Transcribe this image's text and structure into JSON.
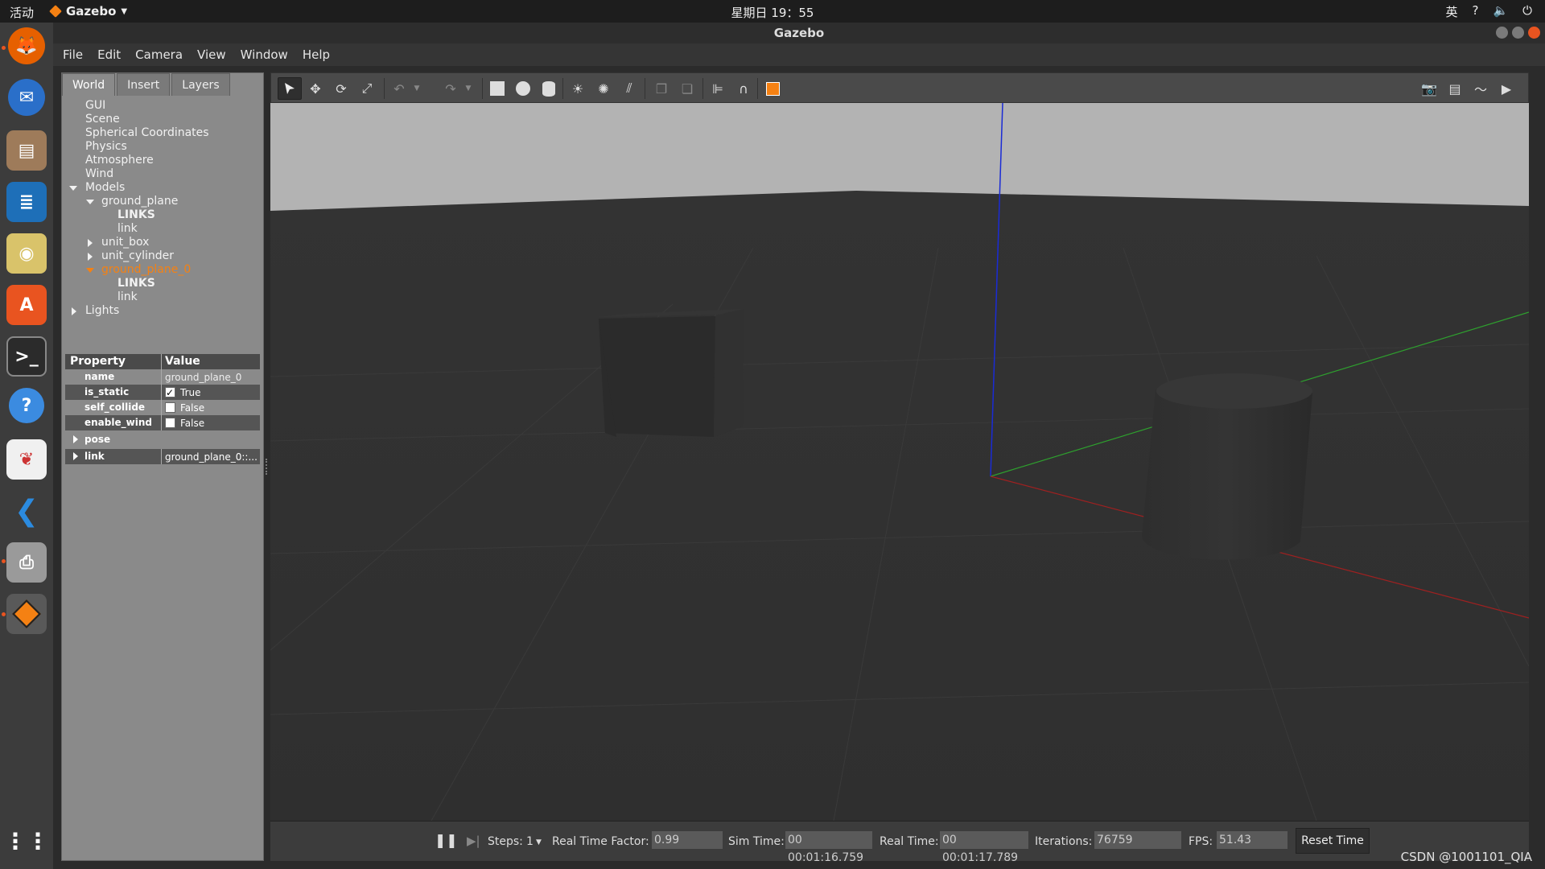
{
  "topbar": {
    "activities": "活动",
    "app_name": "Gazebo",
    "clock": "星期日 19：55",
    "ime": "英",
    "help": "?",
    "volume_icon": "volume-icon",
    "power_icon": "power-icon"
  },
  "dock": {
    "items": [
      "firefox-icon",
      "thunderbird-icon",
      "files-icon",
      "writer-icon",
      "rhythmbox-icon",
      "software-icon",
      "terminal-icon",
      "help-icon",
      "app-icon",
      "vscode-icon",
      "printer-icon",
      "gazebo-icon",
      "app-grid-icon"
    ]
  },
  "window": {
    "title": "Gazebo"
  },
  "menu": {
    "file": "File",
    "edit": "Edit",
    "camera": "Camera",
    "view": "View",
    "window": "Window",
    "help": "Help"
  },
  "panel": {
    "tabs": [
      "World",
      "Insert",
      "Layers"
    ],
    "tree": {
      "gui": "GUI",
      "scene": "Scene",
      "spherical": "Spherical Coordinates",
      "physics": "Physics",
      "atmosphere": "Atmosphere",
      "wind": "Wind",
      "models": "Models",
      "ground_plane": "ground_plane",
      "gp_links": "LINKS",
      "gp_link": "link",
      "unit_box": "unit_box",
      "unit_cylinder": "unit_cylinder",
      "ground_plane_0": "ground_plane_0",
      "gp0_links": "LINKS",
      "gp0_link": "link",
      "lights": "Lights"
    },
    "properties": {
      "header_property": "Property",
      "header_value": "Value",
      "name_key": "name",
      "name_val": "ground_plane_0",
      "is_static_key": "is_static",
      "is_static_val": "True",
      "self_collide_key": "self_collide",
      "self_collide_val": "False",
      "enable_wind_key": "enable_wind",
      "enable_wind_val": "False",
      "pose_key": "pose",
      "link_key": "link",
      "link_val": "ground_plane_0::..."
    }
  },
  "toolbar": {
    "icons": [
      "select-icon",
      "translate-icon",
      "rotate-icon",
      "scale-icon",
      "undo-icon",
      "redo-icon",
      "box-icon",
      "sphere-icon",
      "cylinder-icon",
      "point-light-icon",
      "spot-light-icon",
      "directional-light-icon",
      "copy-icon",
      "paste-icon",
      "align-icon",
      "magnet-icon",
      "view-angle-icon",
      "screenshot-icon",
      "log-icon",
      "plot-icon",
      "record-icon"
    ]
  },
  "status": {
    "steps_label": "Steps:",
    "steps_value": "1",
    "rtf_label": "Real Time Factor:",
    "rtf_value": "0.99",
    "sim_label": "Sim Time:",
    "sim_value": "00 00:01:16.759",
    "real_label": "Real Time:",
    "real_value": "00 00:01:17.789",
    "iter_label": "Iterations:",
    "iter_value": "76759",
    "fps_label": "FPS:",
    "fps_value": "51.43",
    "reset": "Reset Time"
  },
  "watermark": "CSDN @1001101_QIA"
}
